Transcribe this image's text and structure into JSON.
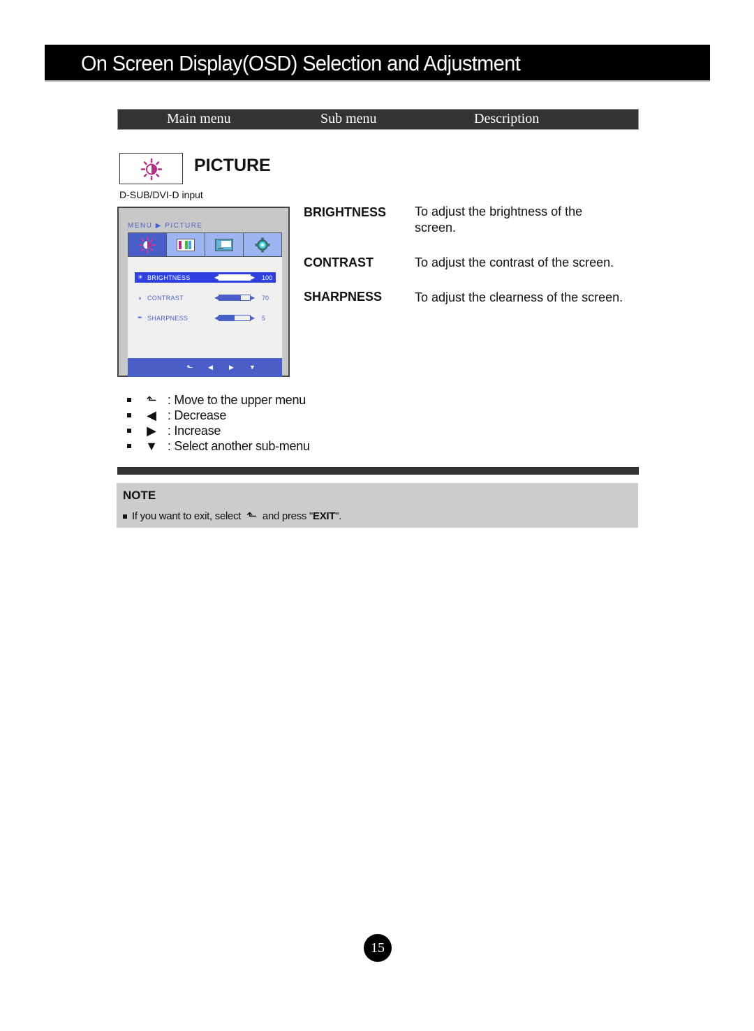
{
  "page_title": "On Screen Display(OSD) Selection and Adjustment",
  "header": {
    "main_menu": "Main menu",
    "sub_menu": "Sub menu",
    "description": "Description"
  },
  "section": {
    "icon": "picture-brightness-icon",
    "title": "PICTURE",
    "input_label": "D-SUB/DVI-D input"
  },
  "osd": {
    "breadcrumb": "MENU ▶ PICTURE",
    "tabs": [
      {
        "icon": "brightness-icon",
        "active": true
      },
      {
        "icon": "color-bars-icon",
        "active": false
      },
      {
        "icon": "display-icon",
        "active": false
      },
      {
        "icon": "settings-gear-icon",
        "active": false
      }
    ],
    "rows": [
      {
        "icon": "☀",
        "label": "BRIGHTNESS",
        "value": "100",
        "level_percent": 100,
        "selected": true
      },
      {
        "icon": "◑",
        "label": "CONTRAST",
        "value": "70",
        "level_percent": 70,
        "selected": false
      },
      {
        "icon": "✒",
        "label": "SHARPNESS",
        "value": "5",
        "level_percent": 50,
        "selected": false
      }
    ],
    "footer_buttons": [
      "⬑",
      "◀",
      "▶",
      "▼"
    ]
  },
  "submenus": [
    {
      "name": "BRIGHTNESS",
      "description": "To adjust the brightness of the screen."
    },
    {
      "name": "CONTRAST",
      "description": "To adjust the contrast of the screen."
    },
    {
      "name": "SHARPNESS",
      "description": "To adjust the clearness of the screen."
    }
  ],
  "legend": [
    {
      "glyph": "⬑",
      "icon": "upper-menu-icon",
      "text": ": Move to the upper menu"
    },
    {
      "glyph": "◀",
      "icon": "decrease-icon",
      "text": ": Decrease"
    },
    {
      "glyph": "▶",
      "icon": "increase-icon",
      "text": ": Increase"
    },
    {
      "glyph": "▼",
      "icon": "next-submenu-icon",
      "text": ": Select another sub-menu"
    }
  ],
  "note": {
    "title": "NOTE",
    "text_before": "If you want to exit, select",
    "text_mid": "and press \"",
    "exit_word": "EXIT",
    "text_after": "\"."
  },
  "page_number": "15",
  "colors": {
    "osd_blue": "#4a5ec8",
    "osd_highlight": "#2e40e0",
    "osd_tab_bg": "#9db5f2",
    "icon_magenta": "#b0308c"
  }
}
